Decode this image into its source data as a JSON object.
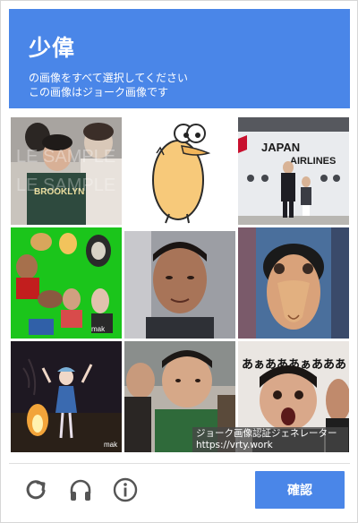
{
  "header": {
    "title": "少偉",
    "instruction_line1": "の画像をすべて選択してください",
    "instruction_line2": "この画像はジョーク画像です"
  },
  "grid": {
    "tiles": [
      {
        "row": 1,
        "col": 1,
        "description": "boy in Brooklyn shirt with watermark"
      },
      {
        "row": 1,
        "col": 2,
        "description": "yellow cartoon bird character"
      },
      {
        "row": 1,
        "col": 3,
        "description": "Japan Airlines aircraft with people"
      },
      {
        "row": 2,
        "col": 1,
        "description": "collage on green screen background"
      },
      {
        "row": 2,
        "col": 2,
        "description": "young man portrait"
      },
      {
        "row": 2,
        "col": 3,
        "description": "shoebill bird mask"
      },
      {
        "row": 3,
        "col": 1,
        "description": "anime dancer by campfire at night"
      },
      {
        "row": 3,
        "col": 2,
        "description": "boy in green shirt"
      },
      {
        "row": 3,
        "col": 3,
        "description": "screaming face with あああ text"
      }
    ],
    "tile_texts": {
      "watermark": "LE SAMPLE",
      "brooklyn": "BROOKLYN",
      "japan": "JAPAN",
      "airlines": "AIRLINES",
      "scream": "あぁあああぁあああ",
      "make": "mak"
    }
  },
  "attribution": {
    "line1": "ジョーク画像認証ジェネレーター",
    "line2": "https://vrty.work"
  },
  "footer": {
    "reload_icon": "reload-icon",
    "audio_icon": "headphones-icon",
    "info_icon": "info-icon",
    "verify_label": "確認"
  },
  "colors": {
    "accent": "#4a86e8",
    "icon_gray": "#555555"
  }
}
